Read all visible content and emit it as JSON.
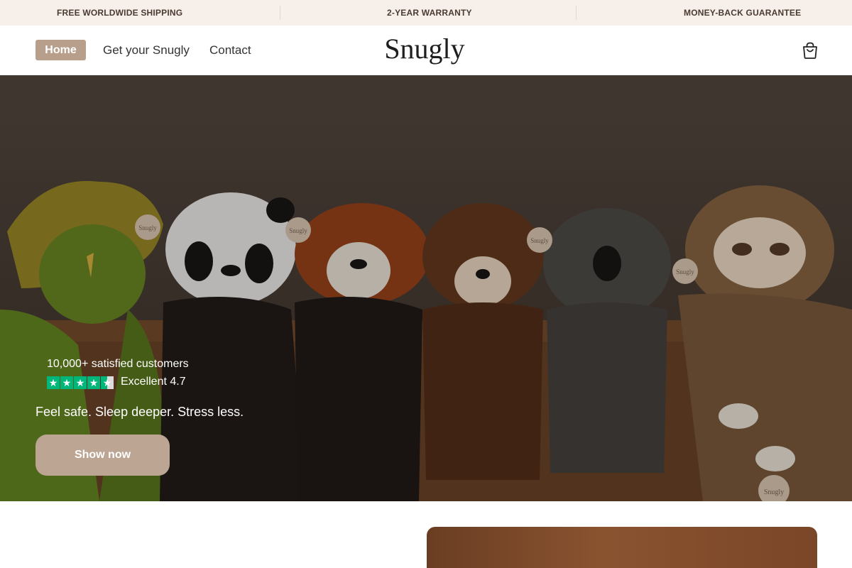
{
  "announcement": {
    "items": [
      "FREE WORLDWIDE SHIPPING",
      "2-YEAR WARRANTY",
      "MONEY-BACK GUARANTEE"
    ]
  },
  "header": {
    "nav": [
      "Home",
      "Get your Snugly",
      "Contact"
    ],
    "logo": "Snugly",
    "cart_icon": "shopping-bag-icon"
  },
  "hero": {
    "customers": "10,000+ satisfied customers",
    "rating_label": "Excellent 4.7",
    "rating_value": 4.7,
    "tagline": "Feel safe. Sleep deeper. Stress less.",
    "cta": "Show now",
    "tag_text": "Snugly"
  },
  "colors": {
    "accent": "#b89f8c",
    "announcement_bg": "#f7efe9",
    "star_green": "#00b67a"
  }
}
